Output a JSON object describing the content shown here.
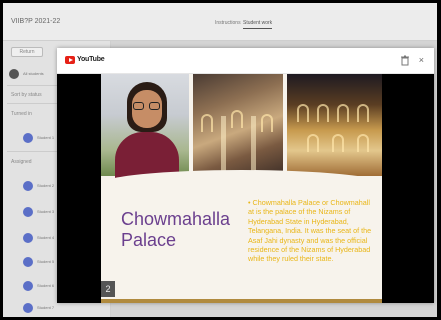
{
  "app": {
    "class_title": "VIIB?P 2021-22",
    "tabs": [
      "Instructions",
      "Student work"
    ]
  },
  "sidebar": {
    "button_label": "Return",
    "heading_1": "Sort by status",
    "heading_2": "Turned in",
    "heading_3": "Assigned",
    "items": [
      {
        "label": "All students"
      },
      {
        "label": "Student 1"
      },
      {
        "label": "Student 2"
      },
      {
        "label": "Student 3"
      },
      {
        "label": "Student 4"
      },
      {
        "label": "Student 5"
      },
      {
        "label": "Student 6"
      },
      {
        "label": "Student 7"
      }
    ]
  },
  "modal": {
    "logo_text": "YouTube",
    "close_label": "×"
  },
  "slide": {
    "title": "Chowmahalla Palace",
    "body": "• Chowmahalla Palace or Chowmahall at is the palace of the Nizams of Hyderabad State in Hyderabad, Telangana, India. It was the seat of the Asaf Jahi dynasty and was the official residence of the Nizams of Hyderabad while they ruled their state.",
    "slide_number": "2"
  },
  "colors": {
    "title_purple": "#6b3f8e",
    "body_yellow": "#e9b617",
    "youtube_red": "#e62117"
  }
}
